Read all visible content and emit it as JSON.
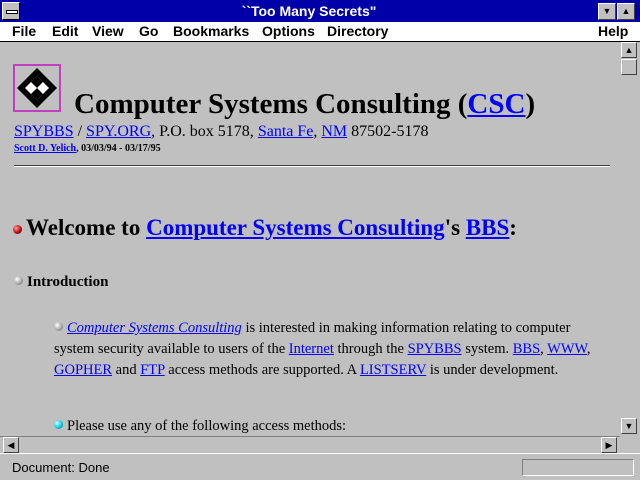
{
  "window": {
    "title": "``Too Many Secrets\""
  },
  "menu": [
    "File",
    "Edit",
    "View",
    "Go",
    "Bookmarks",
    "Options",
    "Directory",
    "Help"
  ],
  "header": {
    "title_prefix": "Computer Systems Consulting (",
    "title_link": "CSC",
    "title_suffix": ")",
    "address": {
      "spybbs": "SPYBBS",
      "sep": " / ",
      "spyorg": "SPY.ORG",
      "pobox": ", P.O. box 5178, ",
      "santafe": "Santa Fe",
      "comma": ", ",
      "nm": "NM",
      "zip": " 87502-5178"
    },
    "author_link": "Scott D. Yelich",
    "author_dates": ", 03/03/94 - 03/17/95"
  },
  "welcome": {
    "prefix": "Welcome to ",
    "csc_link": "Computer Systems Consulting",
    "mid": "'s ",
    "bbs_link": "BBS",
    "suffix": ":"
  },
  "intro_heading": "Introduction",
  "intro": {
    "csc_link": "Computer Systems Consulting",
    "t1": " is interested in making information relating to computer system security available to users of the ",
    "internet": "Internet",
    "t2": " through the ",
    "spybbs": "SPYBBS",
    "t3": " system. ",
    "bbs": "BBS",
    "t4": ", ",
    "www": "WWW",
    "t5": ", ",
    "gopher": "GOPHER",
    "t6": " and ",
    "ftp": "FTP",
    "t7": " access methods are supported. A ",
    "listserv": "LISTSERV",
    "t8": " is under development."
  },
  "access_text": "Please use any of the following access methods:",
  "status": {
    "text": "Document: Done"
  }
}
